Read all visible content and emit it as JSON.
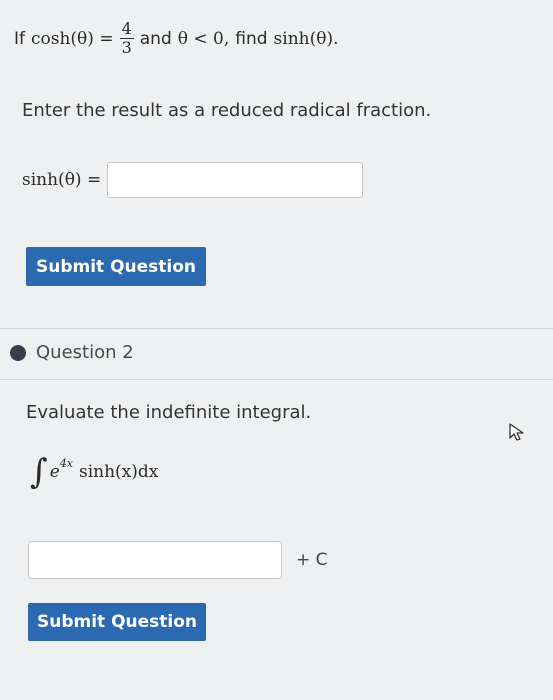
{
  "question1": {
    "prompt_prefix": "If",
    "cosh_expr": "cosh(θ) =",
    "fraction_numerator": "4",
    "fraction_denominator": "3",
    "mid_text": "and",
    "condition": "θ < 0,",
    "find_text": "find",
    "target_expr": "sinh(θ).",
    "instruction": "Enter the result as a reduced radical fraction.",
    "answer_label": "sinh(θ) =",
    "answer_value": "",
    "submit_label": "Submit Question"
  },
  "question2": {
    "title": "Question 2",
    "prompt": "Evaluate the indefinite integral.",
    "integral_sign": "∫",
    "integrand_base": "e",
    "integrand_exponent": "4x",
    "integrand_rest": "sinh(x)dx",
    "answer_value": "",
    "constant_label": "+ C",
    "submit_label": "Submit Question"
  },
  "icons": {
    "cursor": "mouse-pointer-icon",
    "bullet": "question-bullet-icon"
  },
  "colors": {
    "button_bg": "#2b69b0",
    "background": "#eef0f1"
  }
}
